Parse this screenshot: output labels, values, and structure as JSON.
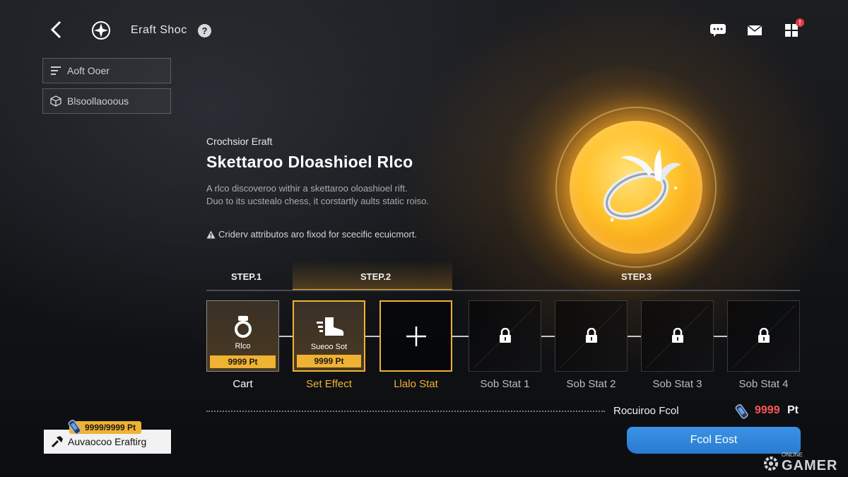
{
  "header": {
    "title": "Eraft Shoc",
    "help_label": "?",
    "mail_badge": "!"
  },
  "side_menu": [
    {
      "label": "Aoft Ooer",
      "icon": "filter-icon"
    },
    {
      "label": "Blsoollaooous",
      "icon": "cube-icon"
    }
  ],
  "item": {
    "subtitle": "Crochsior Eraft",
    "title": "Skettaroo Dloashioel Rlco",
    "description_lines": [
      "A rlco discoveroo withir a skettaroo oloashioel rift.",
      "Duo to its ucstealo chess, it corstartly aults static roiso."
    ],
    "note": "Criderv attributos aro fixod for scecific ecuicmort."
  },
  "steps": [
    "STEP.1",
    "STEP.2",
    "STEP.3"
  ],
  "slots": [
    {
      "label": "Rlco",
      "price": "9999 Pt",
      "caption": "Cart",
      "state": "filled"
    },
    {
      "label": "Sueoo Sot",
      "price": "9999 Pt",
      "caption": "Set Effect",
      "state": "selected"
    },
    {
      "label": "",
      "price": "",
      "caption": "Llalo Stat",
      "state": "add"
    },
    {
      "label": "",
      "price": "",
      "caption": "Sob Stat 1",
      "state": "locked"
    },
    {
      "label": "",
      "price": "",
      "caption": "Sob Stat 2",
      "state": "locked"
    },
    {
      "label": "",
      "price": "",
      "caption": "Sob Stat 3",
      "state": "locked"
    },
    {
      "label": "",
      "price": "",
      "caption": "Sob Stat 4",
      "state": "locked"
    }
  ],
  "footer": {
    "required_label": "Rocuiroo Fcol",
    "required_value": "9999",
    "required_unit": "Pt",
    "action_label": "Fcol Eost",
    "advanced_label": "Auvaocoo Eraftirg",
    "advanced_counter": "9999/9999 Pt"
  },
  "watermark": {
    "small": "ONLINE",
    "big": "GAMER"
  },
  "colors": {
    "accent_gold": "#f0b232",
    "button_blue": "#2a7bd0",
    "cost_red": "#ff5656"
  }
}
